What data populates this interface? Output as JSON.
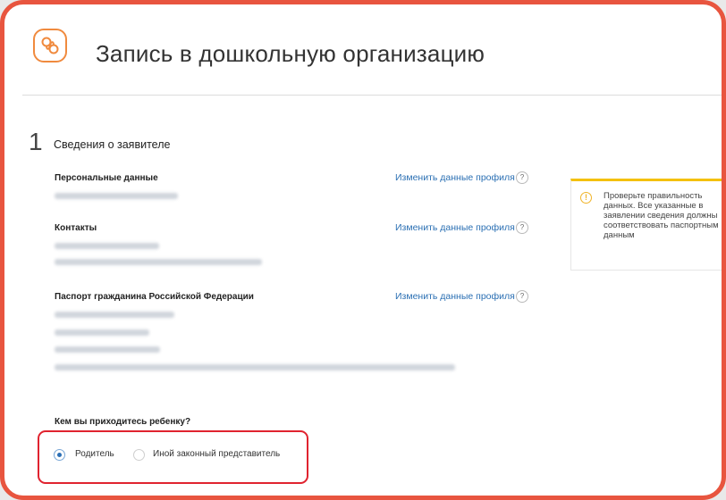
{
  "header": {
    "title": "Запись в дошкольную организацию",
    "logo_icon": "pacifier-icon"
  },
  "step": {
    "number": "1",
    "title": "Сведения о заявителе"
  },
  "sections": {
    "personal": {
      "heading": "Персональные данные"
    },
    "contacts": {
      "heading": "Контакты"
    },
    "passport": {
      "heading": "Паспорт гражданина Российской Федерации"
    }
  },
  "edit_link": {
    "label": "Изменить данные профиля",
    "help": "?"
  },
  "notice": {
    "icon": "!",
    "text": "Проверьте правильность данных. Все указанные в заявлении сведения должны соответствовать паспортным данным"
  },
  "relation": {
    "question": "Кем вы приходитесь ребенку?",
    "options": [
      {
        "label": "Родитель",
        "selected": true
      },
      {
        "label": "Иной законный представитель",
        "selected": false
      }
    ]
  },
  "colors": {
    "accent_frame": "#e8553f",
    "link": "#2a6fb3",
    "notice_bar": "#f4c10f",
    "highlight": "#e0232f"
  }
}
